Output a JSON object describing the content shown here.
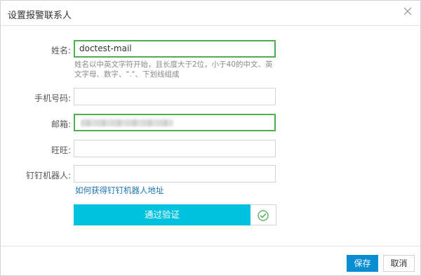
{
  "dialog": {
    "title": "设置报警联系人"
  },
  "form": {
    "name": {
      "label": "姓名:",
      "value": "doctest-mail",
      "hint": "姓名以中英文字符开始，且长度大于2位，小于40的中文、英文字母、数字、\".\"、下划线组成"
    },
    "phone": {
      "label": "手机号码:",
      "value": ""
    },
    "email": {
      "label": "邮箱:"
    },
    "wangwang": {
      "label": "旺旺:",
      "value": ""
    },
    "dingtalk": {
      "label": "钉钉机器人:",
      "value": "",
      "link": "如何获得钉钉机器人地址"
    }
  },
  "verify": {
    "button_label": "通过验证",
    "status_icon": "check-circle-icon",
    "status_color": "#4caf50"
  },
  "footer": {
    "save_label": "保存",
    "cancel_label": "取消"
  },
  "colors": {
    "verify_button": "#00c1de",
    "save_button": "#0a8ed2",
    "valid_border": "#4caf50",
    "link": "#1a73b8"
  }
}
